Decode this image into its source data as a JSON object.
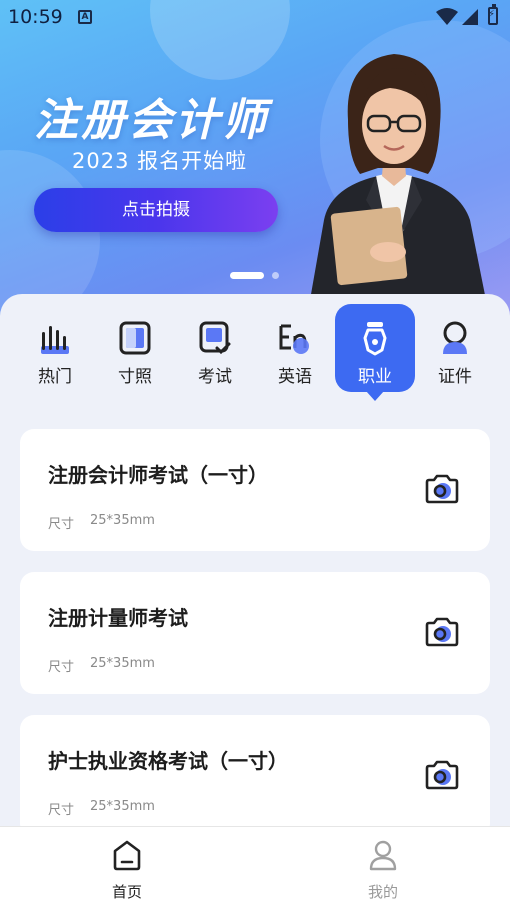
{
  "status_bar": {
    "time": "10:59",
    "indicator": "A"
  },
  "hero": {
    "title": "注册会计师",
    "subtitle": "2023 报名开始啦",
    "cta_label": "点击拍摄",
    "carousel_pages": 2,
    "carousel_active": 1
  },
  "categories": [
    {
      "label": "热门",
      "icon": "bar-chart-icon",
      "active": false
    },
    {
      "label": "寸照",
      "icon": "photo-frame-icon",
      "active": false
    },
    {
      "label": "考试",
      "icon": "exam-check-icon",
      "active": false
    },
    {
      "label": "英语",
      "icon": "english-en-icon",
      "active": false
    },
    {
      "label": "职业",
      "icon": "badge-icon",
      "active": true
    },
    {
      "label": "证件",
      "icon": "id-person-icon",
      "active": false
    }
  ],
  "cards": [
    {
      "title": "注册会计师考试（一寸）",
      "size_label": "尺寸",
      "size_value": "25*35mm"
    },
    {
      "title": "注册计量师考试",
      "size_label": "尺寸",
      "size_value": "25*35mm"
    },
    {
      "title": "护士执业资格考试（一寸）",
      "size_label": "尺寸",
      "size_value": "25*35mm"
    }
  ],
  "bottom_nav": {
    "home_label": "首页",
    "mine_label": "我的",
    "active": "home"
  },
  "colors": {
    "accent": "#3d6af2",
    "cta_gradient_start": "#2b3fe8",
    "cta_gradient_end": "#7b3ff0",
    "page_background": "#eef1f9"
  }
}
